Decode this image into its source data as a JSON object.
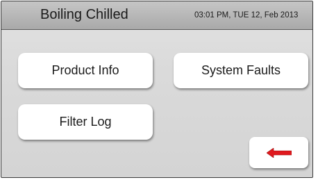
{
  "header": {
    "title": "Boiling Chilled",
    "datetime": "03:01 PM, TUE 12, Feb 2013"
  },
  "menu": {
    "product_info": "Product Info",
    "system_faults": "System Faults",
    "filter_log": "Filter Log"
  },
  "back_button": {
    "icon": "left-arrow-icon",
    "color": "#e0191e"
  }
}
